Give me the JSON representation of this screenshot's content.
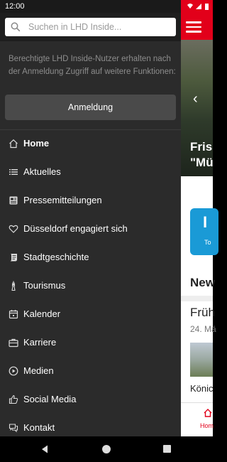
{
  "status_bar": {
    "time": "12:00"
  },
  "background_app": {
    "hero_title_line1": "Fris",
    "hero_title_line2": "\"Mü",
    "tile_letter": "I",
    "tile_label": "To",
    "news_header": "New",
    "news_title": "Früh",
    "news_date": "24. Mä",
    "news_caption": "Könic",
    "bottom_tab_home": "Hom",
    "accent_color": "#e2001a",
    "tile_color": "#1a9ad6"
  },
  "drawer": {
    "search_placeholder": "Suchen in LHD Inside...",
    "info_text": "Berechtigte LHD Inside-Nutzer erhalten nach der Anmeldung Zugriff auf weitere Funktionen:",
    "login_label": "Anmeldung",
    "menu": [
      {
        "label": "Home",
        "icon": "home-icon",
        "active": true
      },
      {
        "label": "Aktuelles",
        "icon": "list-icon"
      },
      {
        "label": "Pressemitteilungen",
        "icon": "newspaper-icon"
      },
      {
        "label": "Düsseldorf engagiert sich",
        "icon": "heart-icon"
      },
      {
        "label": "Stadtgeschichte",
        "icon": "scroll-icon"
      },
      {
        "label": "Tourismus",
        "icon": "tower-icon"
      },
      {
        "label": "Kalender",
        "icon": "calendar-icon"
      },
      {
        "label": "Karriere",
        "icon": "briefcase-icon"
      },
      {
        "label": "Medien",
        "icon": "play-icon"
      },
      {
        "label": "Social Media",
        "icon": "thumbs-up-icon"
      },
      {
        "label": "Kontakt",
        "icon": "chat-icon"
      }
    ]
  }
}
